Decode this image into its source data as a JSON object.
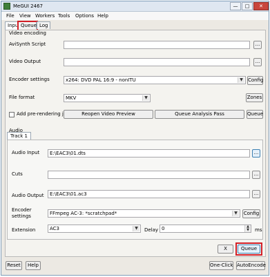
{
  "window": {
    "title": "MeGUI 2467",
    "buttons": {
      "minimize": "—",
      "maximize": "□",
      "close": "✕"
    }
  },
  "menu": [
    "File",
    "View",
    "Workers",
    "Tools",
    "Options",
    "Help"
  ],
  "tabs": [
    {
      "label": "Input",
      "active": true
    },
    {
      "label": "Queue",
      "active": false,
      "highlighted": true
    },
    {
      "label": "Log",
      "active": false
    }
  ],
  "video": {
    "group_label": "Video encoding",
    "avisynth_label": "AviSynth Script",
    "avisynth_value": "",
    "output_label": "Video Output",
    "output_value": "",
    "encoder_label": "Encoder settings",
    "encoder_value": "x264: DVD PAL 16:9 - nonITU",
    "config_label": "Config",
    "format_label": "File format",
    "format_value": "MKV",
    "zones_label": "Zones",
    "prerender_label": "Add pre-rendering job",
    "reopen_label": "Reopen Video Preview",
    "analysis_label": "Queue Analysis Pass",
    "queue_label": "Queue",
    "browse_label": "..."
  },
  "audio": {
    "group_label": "Audio",
    "track_tab": "Track 1",
    "input_label": "Audio Input",
    "input_value": "E:\\EAC3\\01.dts",
    "cuts_label": "Cuts",
    "cuts_value": "",
    "output_label": "Audio Output",
    "output_value": "E:\\EAC3\\01.ac3",
    "encoder_label": "Encoder settings",
    "encoder_value": "FFmpeg AC-3: *scratchpad*",
    "config_label": "Config",
    "extension_label": "Extension",
    "extension_value": "AC3",
    "delay_label": "Delay",
    "delay_value": "0",
    "delay_unit": "ms",
    "x_label": "X",
    "queue_label": "Queue",
    "browse_label": "..."
  },
  "footer": {
    "reset_label": "Reset",
    "help_label": "Help",
    "oneclick_label": "One-Click",
    "autoencode_label": "AutoEncode"
  },
  "colors": {
    "highlight": "#d21f27",
    "close_button": "#c9463d",
    "app_icon": "#3f7f3a"
  }
}
